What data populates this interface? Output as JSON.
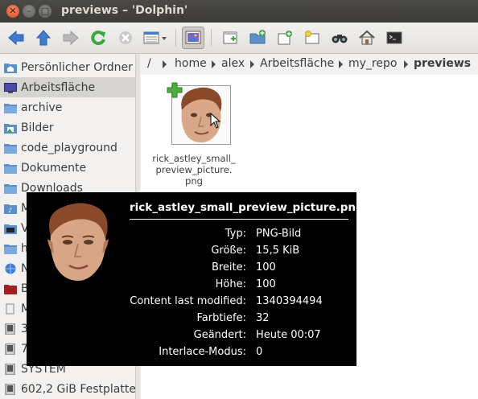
{
  "window": {
    "title": "previews – 'Dolphin'"
  },
  "toolbar": {
    "items": [
      "back-icon",
      "forward-up-icon",
      "forward-icon",
      "reload-icon",
      "stop-icon",
      "view-mode-icon",
      "preview-icon",
      "new-window-icon",
      "new-folder-icon",
      "new-file-icon",
      "new-tab-icon",
      "find-icon",
      "home-icon",
      "terminal-icon"
    ]
  },
  "breadcrumb": {
    "root": "/",
    "items": [
      "home",
      "alex",
      "Arbeitsfläche",
      "my_repo",
      "previews"
    ]
  },
  "sidebar": {
    "items": [
      {
        "label": "Persönlicher Ordner",
        "icon": "home-folder-icon"
      },
      {
        "label": "Arbeitsfläche",
        "icon": "desktop-icon",
        "selected": true
      },
      {
        "label": "archive",
        "icon": "folder-icon"
      },
      {
        "label": "Bilder",
        "icon": "pictures-folder-icon"
      },
      {
        "label": "code_playground",
        "icon": "folder-icon"
      },
      {
        "label": "Dokumente",
        "icon": "folder-icon"
      },
      {
        "label": "Downloads",
        "icon": "folder-icon"
      },
      {
        "label": "M",
        "icon": "music-folder-icon"
      },
      {
        "label": "V",
        "icon": "video-folder-icon"
      },
      {
        "label": "h",
        "icon": "folder-icon"
      },
      {
        "label": "N",
        "icon": "network-icon"
      },
      {
        "label": "B",
        "icon": "trash-icon"
      },
      {
        "label": "M",
        "icon": "bookmark-icon"
      },
      {
        "label": "3",
        "icon": "drive-icon"
      },
      {
        "label": "7",
        "icon": "drive-icon"
      },
      {
        "label": "SYSTEM",
        "icon": "drive-icon"
      },
      {
        "label": "602,2 GiB Festplatte",
        "icon": "drive-icon"
      }
    ]
  },
  "file": {
    "name": "rick_astley_small_preview_picture.png",
    "name_lines": [
      "rick_astley_small_",
      "preview_picture.",
      "png"
    ]
  },
  "tooltip": {
    "title": "rick_astley_small_preview_picture.png",
    "rows": [
      {
        "key": "Typ:",
        "value": "PNG-Bild"
      },
      {
        "key": "Größe:",
        "value": "15,5 KiB"
      },
      {
        "key": "Breite:",
        "value": "100"
      },
      {
        "key": "Höhe:",
        "value": "100"
      },
      {
        "key": "Content last modified:",
        "value": "1340394494"
      },
      {
        "key": "Farbtiefe:",
        "value": "32"
      },
      {
        "key": "Geändert:",
        "value": "Heute 00:07"
      },
      {
        "key": "Interlace-Modus:",
        "value": "0"
      }
    ]
  },
  "colors": {
    "accent": "#3b7dd8",
    "selection": "#d6d4d0",
    "tooltip_bg": "#000000",
    "folder": "#5b8fc9"
  }
}
